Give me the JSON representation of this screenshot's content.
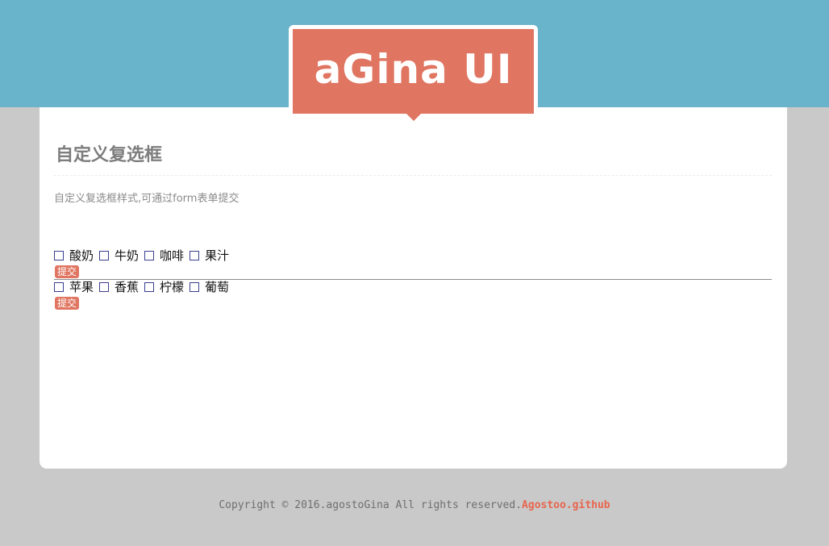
{
  "brand": {
    "logo_text": "aGina UI"
  },
  "page": {
    "title": "自定义复选框",
    "description": "自定义复选框样式,可通过form表单提交"
  },
  "forms": [
    {
      "options": [
        {
          "label": "酸奶",
          "checked": false
        },
        {
          "label": "牛奶",
          "checked": false
        },
        {
          "label": "咖啡",
          "checked": false
        },
        {
          "label": "果汁",
          "checked": false
        }
      ],
      "submit_label": "提交"
    },
    {
      "options": [
        {
          "label": "苹果",
          "checked": false
        },
        {
          "label": "香蕉",
          "checked": false
        },
        {
          "label": "柠檬",
          "checked": false
        },
        {
          "label": "葡萄",
          "checked": false
        }
      ],
      "submit_label": "提交"
    }
  ],
  "footer": {
    "copyright": "Copyright © 2016.agostoGina All rights reserved.",
    "link_text": "Agostoo.github"
  },
  "colors": {
    "header_blue": "#69b3cb",
    "accent": "#e07561",
    "background": "#c9c9c9",
    "link": "#e8664e"
  }
}
